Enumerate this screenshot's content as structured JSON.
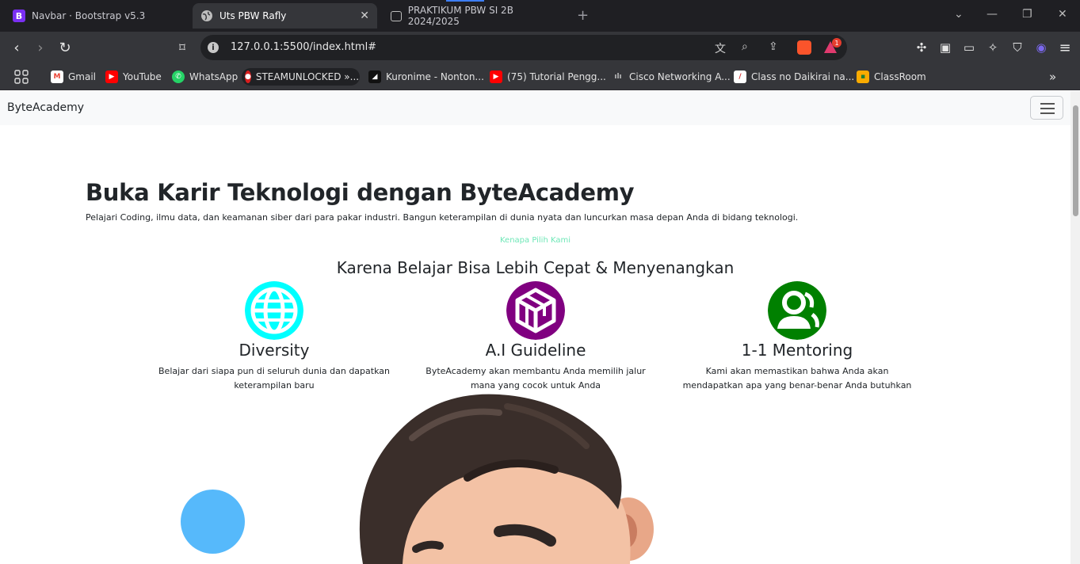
{
  "browser": {
    "tabs": [
      {
        "label": "Navbar · Bootstrap v5.3",
        "active": false
      },
      {
        "label": "Uts PBW Rafly",
        "active": true
      },
      {
        "label": "PRAKTIKUM PBW SI 2B 2024/2025",
        "active": false
      }
    ],
    "url": "127.0.0.1:5500/index.html#",
    "rewards_badge": "1",
    "bookmarks": [
      "Gmail",
      "YouTube",
      "WhatsApp",
      "STEAMUNLOCKED »...",
      "Kuronime - Nonton...",
      "(75) Tutorial Pengg...",
      "Cisco Networking A...",
      "Class no Daikirai na...",
      "ClassRoom"
    ]
  },
  "navbar": {
    "brand": "ByteAcademy"
  },
  "hero": {
    "title": "Buka Karir Teknologi dengan ByteAcademy",
    "subtitle": "Pelajari Coding, ilmu data, dan keamanan siber dari para pakar industri. Bangun keterampilan di dunia nyata dan luncurkan masa depan Anda di bidang teknologi."
  },
  "features_section": {
    "kicker": "Kenapa Pilih Kami",
    "title": "Karena Belajar Bisa Lebih Cepat & Menyenangkan",
    "items": [
      {
        "title": "Diversity",
        "desc": "Belajar dari siapa pun di seluruh dunia dan dapatkan keterampilan baru",
        "icon": "globe-icon",
        "color": "#00ffff"
      },
      {
        "title": "A.I Guideline",
        "desc": "ByteAcademy akan membantu Anda memilih jalur mana yang cocok untuk Anda",
        "icon": "codepen-icon",
        "color": "#800080"
      },
      {
        "title": "1-1 Mentoring",
        "desc": "Kami akan memastikan bahwa Anda akan mendapatkan apa yang benar-benar Anda butuhkan",
        "icon": "people-icon",
        "color": "#008000"
      }
    ]
  },
  "colors": {
    "accent_blob": "#56b9fb",
    "kicker": "#6ee7b7"
  }
}
